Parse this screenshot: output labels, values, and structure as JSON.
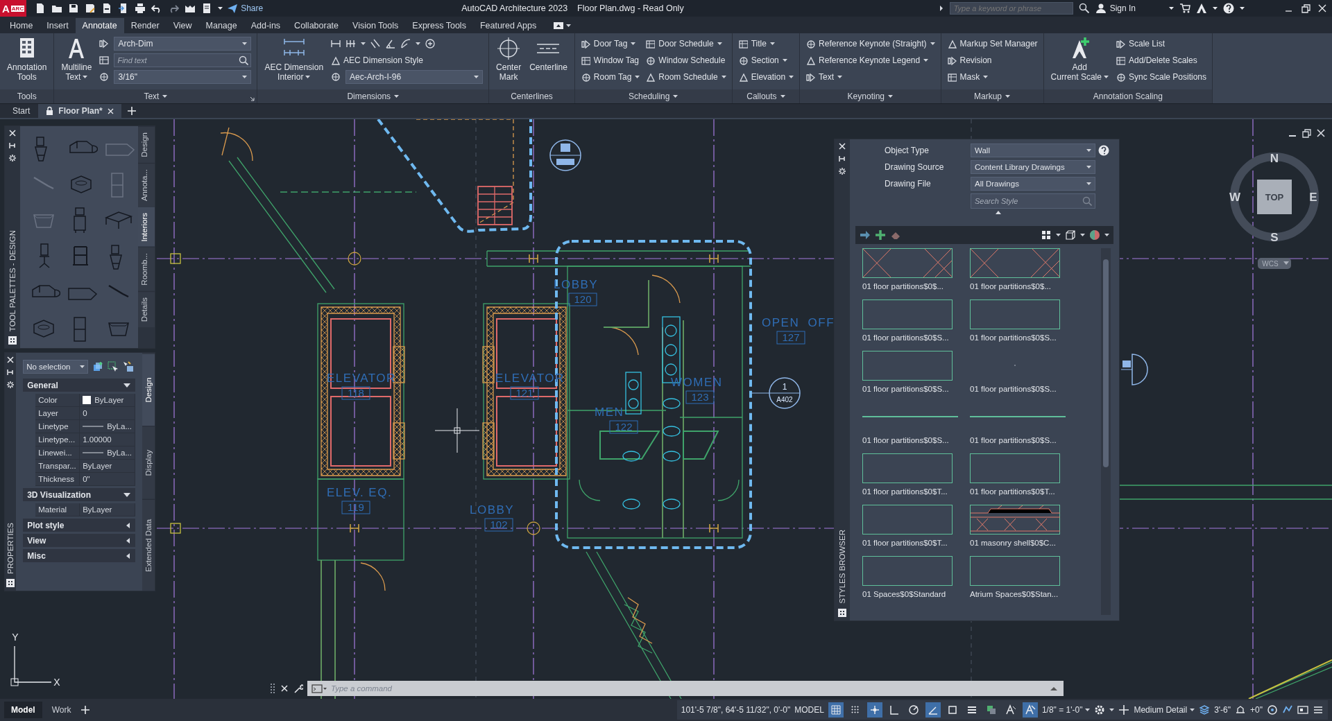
{
  "title_bar": {
    "logo_letter": "A",
    "logo_badge": "ARC",
    "share": "Share",
    "app_title": "AutoCAD Architecture 2023",
    "file_title": "Floor Plan.dwg - Read Only",
    "search": {
      "placeholder": "Type a keyword or phrase"
    },
    "sign_in": "Sign In"
  },
  "ribbon_tabs": [
    {
      "label": "Home",
      "selected": false
    },
    {
      "label": "Insert",
      "selected": false
    },
    {
      "label": "Annotate",
      "selected": true
    },
    {
      "label": "Render",
      "selected": false
    },
    {
      "label": "View",
      "selected": false
    },
    {
      "label": "Manage",
      "selected": false
    },
    {
      "label": "Add-ins",
      "selected": false
    },
    {
      "label": "Collaborate",
      "selected": false
    },
    {
      "label": "Vision Tools",
      "selected": false
    },
    {
      "label": "Express Tools",
      "selected": false
    },
    {
      "label": "Featured Apps",
      "selected": false
    }
  ],
  "ribbon_panels": [
    {
      "label": "Tools",
      "menu": false,
      "launcher": false,
      "large": [
        {
          "lines": [
            "Annotation",
            "Tools"
          ],
          "menu": false
        }
      ]
    },
    {
      "label": "Text",
      "menu": true,
      "launcher": true,
      "large": [
        {
          "lines": [
            "Multiline",
            "Text"
          ],
          "menu": true
        }
      ],
      "columns": [
        [
          {
            "kind": "dropdown",
            "value": "Arch-Dim"
          },
          {
            "kind": "search",
            "placeholder": "Find text"
          },
          {
            "kind": "dropdown",
            "value": "3/16\""
          }
        ]
      ]
    },
    {
      "label": "Dimensions",
      "menu": true,
      "launcher": false,
      "large": [
        {
          "lines": [
            "AEC Dimension",
            "Interior"
          ],
          "menu": true
        }
      ],
      "columns": [
        [
          {
            "kind": "tools"
          },
          {
            "kind": "button",
            "label": "AEC Dimension Style",
            "menu": false
          },
          {
            "kind": "dropdown",
            "value": "Aec-Arch-I-96"
          }
        ]
      ]
    },
    {
      "label": "Centerlines",
      "menu": false,
      "launcher": false,
      "large": [
        {
          "lines": [
            "Center",
            "Mark"
          ],
          "menu": false
        },
        {
          "lines": [
            "Centerline"
          ],
          "menu": false
        }
      ]
    },
    {
      "label": "Scheduling",
      "menu": true,
      "launcher": false,
      "columns": [
        [
          {
            "kind": "button",
            "label": "Door Tag",
            "menu": true
          },
          {
            "kind": "button",
            "label": "Window Tag",
            "menu": false
          },
          {
            "kind": "button",
            "label": "Room Tag",
            "menu": true
          }
        ],
        [
          {
            "kind": "button",
            "label": "Door Schedule",
            "menu": true
          },
          {
            "kind": "button",
            "label": "Window Schedule",
            "menu": false
          },
          {
            "kind": "button",
            "label": "Room Schedule",
            "menu": true
          }
        ]
      ]
    },
    {
      "label": "Callouts",
      "menu": true,
      "launcher": false,
      "columns": [
        [
          {
            "kind": "button",
            "label": "Title",
            "menu": true
          },
          {
            "kind": "button",
            "label": "Section",
            "menu": true
          },
          {
            "kind": "button",
            "label": "Elevation",
            "menu": true
          }
        ]
      ]
    },
    {
      "label": "Keynoting",
      "menu": true,
      "launcher": false,
      "columns": [
        [
          {
            "kind": "button",
            "label": "Reference Keynote (Straight)",
            "menu": true
          },
          {
            "kind": "button",
            "label": "Reference Keynote Legend",
            "menu": true
          },
          {
            "kind": "button",
            "label": "Text",
            "menu": true
          }
        ]
      ]
    },
    {
      "label": "Markup",
      "menu": true,
      "launcher": false,
      "columns": [
        [
          {
            "kind": "button",
            "label": "Markup Set Manager",
            "menu": false
          },
          {
            "kind": "button",
            "label": "Revision",
            "menu": false
          },
          {
            "kind": "button",
            "label": "Mask",
            "menu": true
          }
        ]
      ]
    },
    {
      "label": "Annotation Scaling",
      "menu": false,
      "launcher": false,
      "large": [
        {
          "lines": [
            "Add",
            "Current Scale"
          ],
          "menu": true
        }
      ],
      "columns": [
        [
          {
            "kind": "button",
            "label": "Scale List",
            "menu": false
          },
          {
            "kind": "button",
            "label": "Add/Delete Scales",
            "menu": false
          },
          {
            "kind": "button",
            "label": "Sync Scale Positions",
            "menu": false
          }
        ]
      ]
    }
  ],
  "doc_tabs": [
    {
      "label": "Start",
      "selected": false,
      "locked": false
    },
    {
      "label": "Floor Plan*",
      "selected": true,
      "locked": true
    }
  ],
  "tool_palette": {
    "title": "TOOL PALETTES - DESIGN",
    "tabs": [
      {
        "label": "Design",
        "selected": false
      },
      {
        "label": "Annota...",
        "selected": false
      },
      {
        "label": "Interiors",
        "selected": true
      },
      {
        "label": "Roomb...",
        "selected": false
      },
      {
        "label": "Details",
        "selected": false
      }
    ]
  },
  "properties": {
    "title": "PROPERTIES",
    "selection": "No selection",
    "sections": [
      {
        "title": "General",
        "expanded": true,
        "rows": [
          {
            "label": "Color",
            "value": "ByLayer",
            "kind": "swatch"
          },
          {
            "label": "Layer",
            "value": "0",
            "kind": "text"
          },
          {
            "label": "Linetype",
            "value": "ByLa...",
            "kind": "line"
          },
          {
            "label": "Linetype...",
            "value": "1.00000",
            "kind": "text"
          },
          {
            "label": "Linewei...",
            "value": "ByLa...",
            "kind": "line"
          },
          {
            "label": "Transpar...",
            "value": "ByLayer",
            "kind": "text"
          },
          {
            "label": "Thickness",
            "value": "0\"",
            "kind": "text"
          }
        ]
      },
      {
        "title": "3D Visualization",
        "expanded": true,
        "rows": [
          {
            "label": "Material",
            "value": "ByLayer",
            "kind": "text"
          }
        ]
      },
      {
        "title": "Plot style",
        "expanded": false
      },
      {
        "title": "View",
        "expanded": false
      },
      {
        "title": "Misc",
        "expanded": false
      }
    ],
    "tabs": [
      {
        "label": "Design",
        "selected": true
      },
      {
        "label": "Display",
        "selected": false
      },
      {
        "label": "Extended Data",
        "selected": false
      }
    ]
  },
  "drawing": {
    "room_labels": [
      {
        "name": "LOBBY",
        "number": "120"
      },
      {
        "name": "OPEN  OFF",
        "number": "127"
      },
      {
        "name": "ELEVATOR",
        "number": "118"
      },
      {
        "name": "ELEVATOR",
        "number": "121"
      },
      {
        "name": "WOMEN",
        "number": "123"
      },
      {
        "name": "MEN",
        "number": "122"
      },
      {
        "name": "ELEV. EQ.",
        "number": "119"
      },
      {
        "name": "LOBBY",
        "number": "102"
      }
    ],
    "callout": {
      "number": "1",
      "sheet": "A402"
    },
    "compass": {
      "north": "N",
      "south": "S",
      "east": "E",
      "west": "W",
      "view": "TOP",
      "ucs": "WCS"
    },
    "ucs_axes": {
      "x": "X",
      "y": "Y"
    }
  },
  "styles_browser": {
    "title": "STYLES BROWSER",
    "fields": [
      {
        "label": "Object Type",
        "value": "Wall"
      },
      {
        "label": "Drawing Source",
        "value": "Content Library Drawings"
      },
      {
        "label": "Drawing File",
        "value": "All Drawings"
      }
    ],
    "search": {
      "placeholder": "Search Style"
    },
    "styles": [
      {
        "name": "01 floor partitions$0$...",
        "kind": "hatched"
      },
      {
        "name": "01 floor partitions$0$...",
        "kind": "hatched"
      },
      {
        "name": "01 floor partitions$0$S...",
        "kind": "plain"
      },
      {
        "name": "01 floor partitions$0$S...",
        "kind": "plain"
      },
      {
        "name": "01 floor partitions$0$S...",
        "kind": "plain"
      },
      {
        "name": "01 floor partitions$0$S...",
        "kind": "blank"
      },
      {
        "name": "01 floor partitions$0$S...",
        "kind": "line"
      },
      {
        "name": "01 floor partitions$0$S...",
        "kind": "line"
      },
      {
        "name": "01 floor partitions$0$T...",
        "kind": "plain"
      },
      {
        "name": "01 floor partitions$0$T...",
        "kind": "plain"
      },
      {
        "name": "01 floor partitions$0$T...",
        "kind": "plain"
      },
      {
        "name": "01 masonry shell$0$C...",
        "kind": "masonry"
      },
      {
        "name": "01 Spaces$0$Standard",
        "kind": "plain"
      },
      {
        "name": "Atrium Spaces$0$Stan...",
        "kind": "plain"
      }
    ]
  },
  "command_line": {
    "placeholder": "Type a command"
  },
  "status_bar": {
    "layout_tabs": [
      {
        "label": "Model",
        "selected": true
      },
      {
        "label": "Work",
        "selected": false
      }
    ],
    "coordinates": "101'-5 7/8\", 64'-5 11/32\", 0'-0\"",
    "space": "MODEL",
    "toggles": [
      {
        "kind": "grid",
        "on": true
      },
      {
        "kind": "snap",
        "on": false
      },
      {
        "kind": "infer",
        "on": true
      },
      {
        "kind": "ortho",
        "on": false
      },
      {
        "kind": "polar",
        "on": false
      },
      {
        "kind": "isodraft",
        "on": true
      },
      {
        "kind": "osnap",
        "on": false
      },
      {
        "kind": "lineweight",
        "on": false
      },
      {
        "kind": "transparency",
        "on": false
      },
      {
        "kind": "visibility",
        "on": false
      },
      {
        "kind": "autoscale",
        "on": true
      }
    ],
    "annotation_scale": "1/8\" = 1'-0\"",
    "detail_level": "Medium Detail",
    "cut_plane": "3'-6\"",
    "elevation": "+0\""
  }
}
